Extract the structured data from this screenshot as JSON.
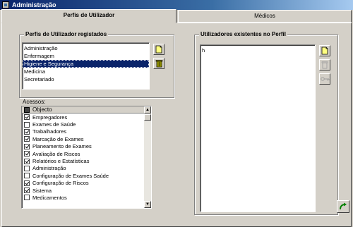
{
  "window": {
    "title": "Administração"
  },
  "tabs": [
    {
      "label": "Perfis de Utilizador"
    },
    {
      "label": "Médicos"
    }
  ],
  "profiles": {
    "caption": "Perfis de Utilizador registados",
    "items": [
      "Administração",
      "Enfermagem",
      "Higiene e Segurança",
      "Medicina",
      "Secretariado"
    ],
    "selected_index": 2
  },
  "access": {
    "label": "Acessos:",
    "header": "Objecto",
    "rows": [
      {
        "label": "Empregadores",
        "checked": true
      },
      {
        "label": "Exames de Saúde",
        "checked": false
      },
      {
        "label": "Trabalhadores",
        "checked": true
      },
      {
        "label": "Marcação de Exames",
        "checked": true
      },
      {
        "label": "Planeamento de Exames",
        "checked": true
      },
      {
        "label": "Avaliação de Riscos",
        "checked": true
      },
      {
        "label": "Relatórios e Estatísticas",
        "checked": true
      },
      {
        "label": "Administração",
        "checked": false
      },
      {
        "label": "Configuração de Exames Saúde",
        "checked": false
      },
      {
        "label": "Configuração de Riscos",
        "checked": true
      },
      {
        "label": "Sistema",
        "checked": true
      },
      {
        "label": "Medicamentos",
        "checked": false
      }
    ]
  },
  "users": {
    "caption": "Utilizadores existentes no Perfil",
    "items": [
      "h"
    ]
  }
}
